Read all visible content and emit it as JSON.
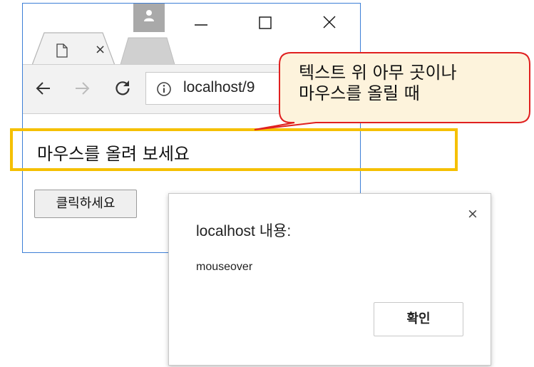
{
  "browser": {
    "tab_close_glyph": "×",
    "url": "localhost/9"
  },
  "page": {
    "text": "마우스를 올려 보세요",
    "button_label": "클릭하세요"
  },
  "callout": {
    "line1": "텍스트 위 아무 곳이나",
    "line2": "마우스를 올릴 때"
  },
  "dialog": {
    "title": "localhost 내용:",
    "message": "mouseover",
    "close_glyph": "×",
    "ok_label": "확인"
  },
  "colors": {
    "window_border": "#3d7fd6",
    "highlight": "#f5c000",
    "callout_fill": "#fdf3dc",
    "callout_border": "#e02020"
  }
}
